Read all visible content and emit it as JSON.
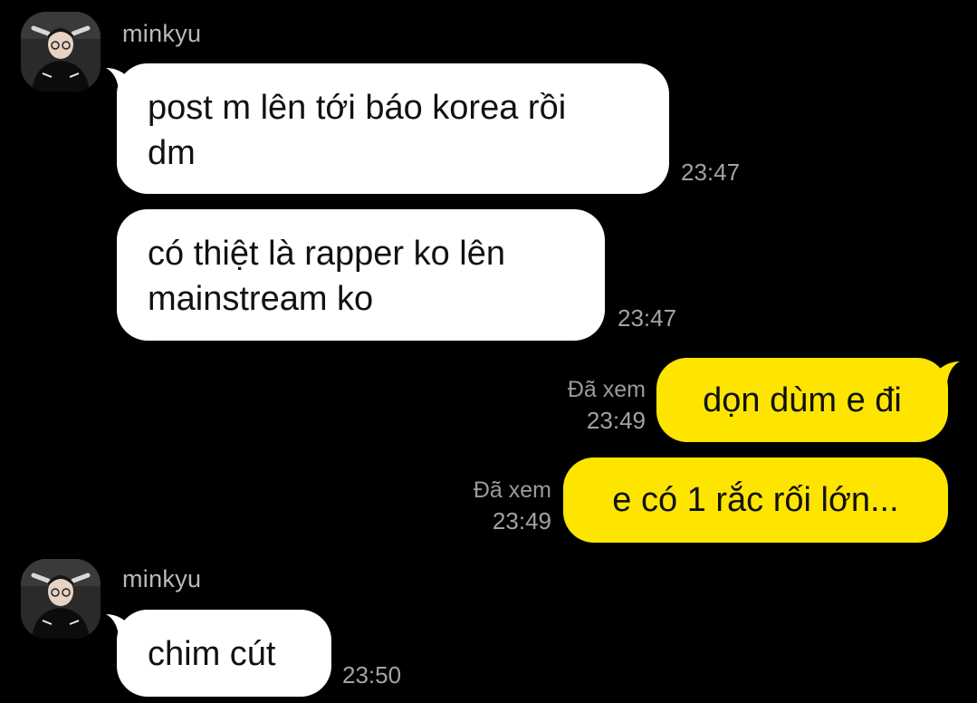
{
  "sender": {
    "name": "minkyu",
    "avatar_icon": "user-photo-icon"
  },
  "colors": {
    "background": "#000000",
    "incoming_bubble": "#ffffff",
    "outgoing_bubble": "#fee500",
    "meta_text": "#a2a2a2"
  },
  "messages": [
    {
      "direction": "in",
      "lines": [
        "post m lên tới báo korea rồi",
        "dm"
      ],
      "time": "23:47"
    },
    {
      "direction": "in",
      "lines": [
        "có thiệt là rapper ko lên",
        "mainstream ko"
      ],
      "time": "23:47"
    },
    {
      "direction": "out",
      "text": "dọn dùm e đi",
      "read_label": "Đã xem",
      "time": "23:49"
    },
    {
      "direction": "out",
      "text": "e có 1 rắc rối lớn...",
      "read_label": "Đã xem",
      "time": "23:49"
    },
    {
      "direction": "in",
      "lines": [
        "chim cút"
      ],
      "time": "23:50"
    }
  ]
}
